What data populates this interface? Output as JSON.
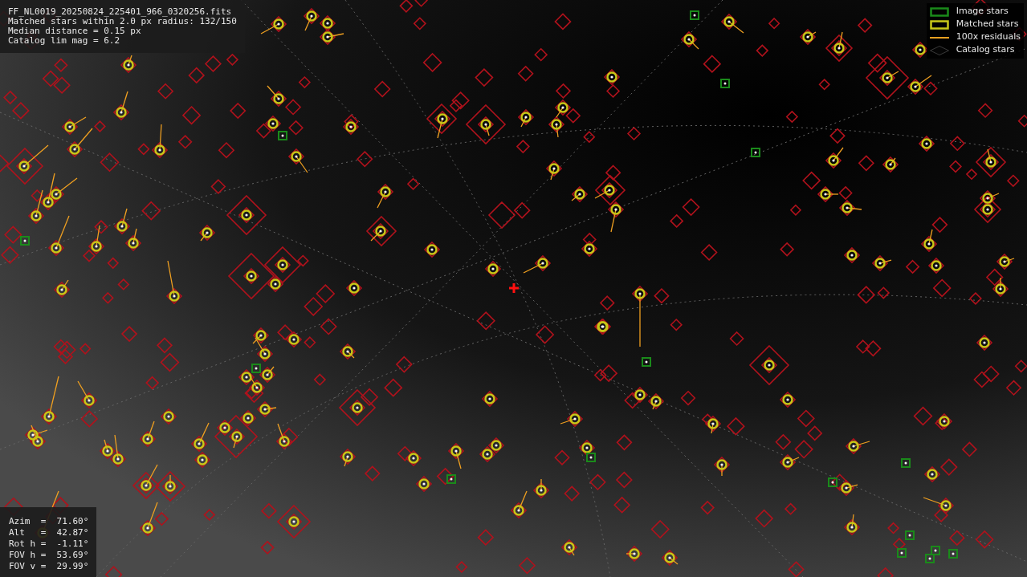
{
  "info": [
    "FF_NL0019_20250824_225401_966_0320256.fits",
    "Matched stars within 2.0 px radius: 132/150",
    "Median distance = 0.15 px",
    "Catalog lim mag = 6.2"
  ],
  "legend": [
    {
      "kind": "image",
      "label": "Image stars"
    },
    {
      "kind": "matched",
      "label": "Matched stars"
    },
    {
      "kind": "residual",
      "label": "100x residuals"
    },
    {
      "kind": "catalog",
      "label": "Catalog stars"
    }
  ],
  "pointing": [
    "Azim  =  71.60°",
    "Alt   =  42.87°",
    "Rot h =  -1.11°",
    "FOV h =  53.69°",
    "FOV v =  29.99°"
  ]
}
